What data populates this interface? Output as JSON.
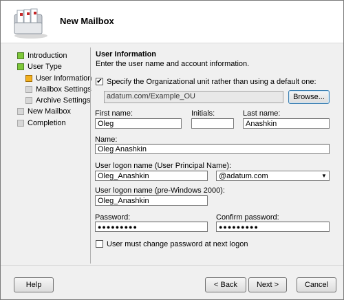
{
  "window": {
    "title": "New Mailbox"
  },
  "nav": {
    "items": [
      {
        "label": "Introduction",
        "state": "done"
      },
      {
        "label": "User Type",
        "state": "done"
      },
      {
        "label": "User Information",
        "state": "current"
      },
      {
        "label": "Mailbox Settings",
        "state": "pending"
      },
      {
        "label": "Archive Settings",
        "state": "pending"
      },
      {
        "label": "New Mailbox",
        "state": "pending"
      },
      {
        "label": "Completion",
        "state": "pending"
      }
    ]
  },
  "section": {
    "title": "User Information",
    "subtitle": "Enter the user name and account information."
  },
  "ou": {
    "checkbox_label": "Specify the Organizational unit rather than using a default one:",
    "checked": true,
    "value": "adatum.com/Example_OU",
    "browse_label": "Browse..."
  },
  "fields": {
    "first_name_label": "First name:",
    "first_name": "Oleg",
    "initials_label": "Initials:",
    "initials": "",
    "last_name_label": "Last name:",
    "last_name": "Anashkin",
    "name_label": "Name:",
    "name": "Oleg Anashkin",
    "upn_label": "User logon name (User Principal Name):",
    "upn": "Oleg_Anashkin",
    "upn_domain": "@adatum.com",
    "pre2000_label": "User logon name (pre-Windows 2000):",
    "pre2000": "Oleg_Anashkin",
    "password_label": "Password:",
    "password": "●●●●●●●●●",
    "confirm_label": "Confirm password:",
    "confirm": "●●●●●●●●●",
    "change_pw_label": "User must change password at next logon",
    "change_pw_checked": false
  },
  "buttons": {
    "help": "Help",
    "back": "< Back",
    "next": "Next >",
    "cancel": "Cancel"
  }
}
